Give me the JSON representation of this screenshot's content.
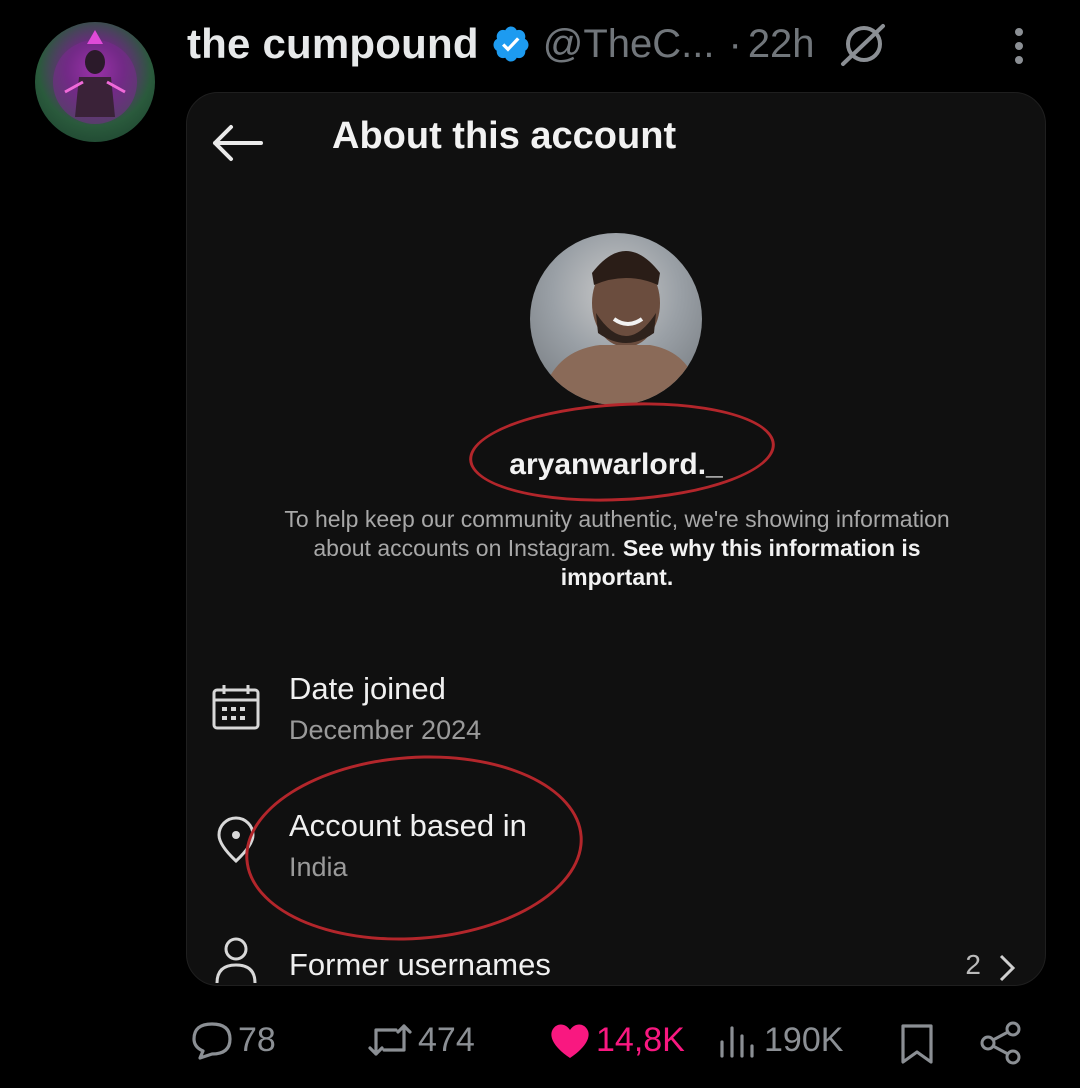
{
  "tweet": {
    "display_name": "the cumpound",
    "handle": "@TheC...",
    "separator": "·",
    "time": "22h",
    "colors": {
      "verified": "#1d9bf0",
      "like": "#f91880",
      "muted": "#71767b",
      "annotation": "#b3262b"
    }
  },
  "embedded": {
    "title": "About this account",
    "username": "aryanwarlord._",
    "info": {
      "text": "To help keep our community authentic, we're showing information about accounts on Instagram. ",
      "link": "See why this information is important."
    },
    "rows": [
      {
        "label": "Date joined",
        "value": "December 2024",
        "icon": "calendar-icon"
      },
      {
        "label": "Account based in",
        "value": "India",
        "icon": "location-pin-icon"
      },
      {
        "label": "Former usernames",
        "count": "2",
        "icon": "person-icon"
      }
    ]
  },
  "actions": {
    "replies": "78",
    "reposts": "474",
    "likes": "14,8K",
    "views": "190K"
  }
}
